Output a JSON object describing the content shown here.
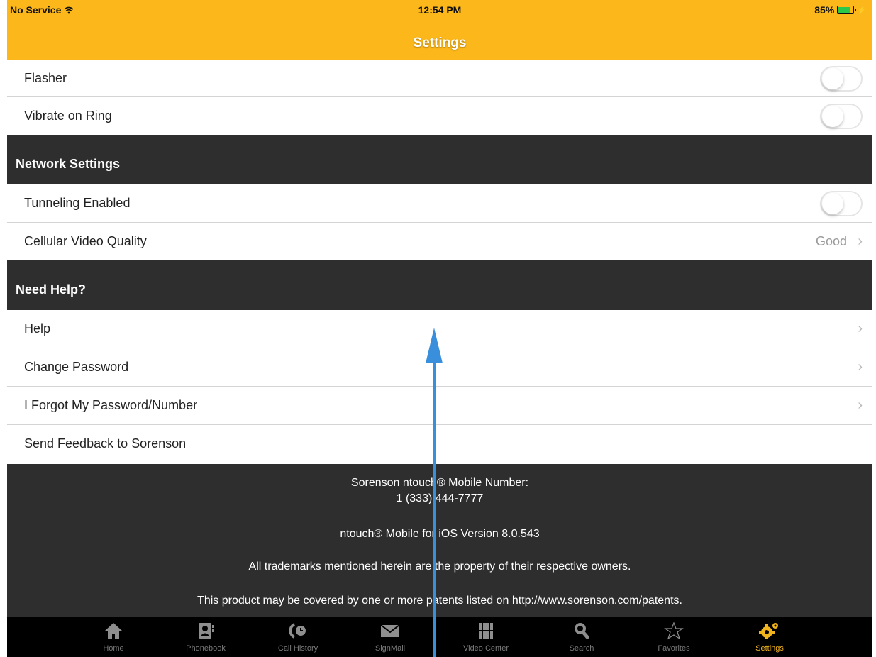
{
  "status": {
    "carrier": "No Service",
    "time": "12:54 PM",
    "battery": "85%",
    "battery_level": 0.85
  },
  "nav": {
    "title": "Settings"
  },
  "rows": {
    "flasher": {
      "label": "Flasher",
      "on": false
    },
    "vibrate": {
      "label": "Vibrate on Ring",
      "on": false
    },
    "tunneling": {
      "label": "Tunneling Enabled",
      "on": false
    },
    "cellular": {
      "label": "Cellular Video Quality",
      "value": "Good"
    },
    "help": {
      "label": "Help"
    },
    "change_password": {
      "label": "Change Password"
    },
    "forgot": {
      "label": "I Forgot My Password/Number"
    },
    "feedback": {
      "label": "Send Feedback to Sorenson"
    }
  },
  "sections": {
    "network": "Network Settings",
    "help": "Need Help?"
  },
  "footer": {
    "number_label": "Sorenson ntouch® Mobile Number:",
    "number": "1 (333) 444-7777",
    "version": "ntouch® Mobile for iOS Version 8.0.543",
    "trademarks": "All trademarks mentioned herein are the property of their respective owners.",
    "patents": "This product may be covered by one or more patents listed on http://www.sorenson.com/patents."
  },
  "tabs": [
    {
      "label": "Home",
      "icon": "home-icon"
    },
    {
      "label": "Phonebook",
      "icon": "phonebook-icon"
    },
    {
      "label": "Call History",
      "icon": "call-history-icon"
    },
    {
      "label": "SignMail",
      "icon": "envelope-icon"
    },
    {
      "label": "Video Center",
      "icon": "film-icon"
    },
    {
      "label": "Search",
      "icon": "search-icon"
    },
    {
      "label": "Favorites",
      "icon": "star-icon"
    },
    {
      "label": "Settings",
      "icon": "gears-icon",
      "active": true
    }
  ],
  "colors": {
    "brand": "#fcb81b",
    "section": "#2e2e2e",
    "accent": "#f2b41c",
    "arrow": "#3a8fdc"
  }
}
